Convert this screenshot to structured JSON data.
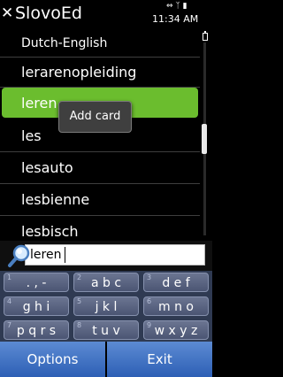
{
  "app": {
    "title": "SlovoEd"
  },
  "status": {
    "time": "11:34 AM"
  },
  "dictionary": {
    "name": "Dutch-English"
  },
  "list": {
    "items": [
      "lerarenopleiding",
      "leren",
      "les",
      "lesauto",
      "lesbienne",
      "lesbisch"
    ],
    "selected": "leren"
  },
  "context_menu": {
    "label": "Add card"
  },
  "search": {
    "value": "leren"
  },
  "keypad": {
    "keys": [
      {
        "num": "1",
        "label": ". , -"
      },
      {
        "num": "2",
        "label": "a b c"
      },
      {
        "num": "3",
        "label": "d e f"
      },
      {
        "num": "4",
        "label": "g h i"
      },
      {
        "num": "5",
        "label": "j k l"
      },
      {
        "num": "6",
        "label": "m n o"
      },
      {
        "num": "7",
        "label": "p q r s"
      },
      {
        "num": "8",
        "label": "t u v"
      },
      {
        "num": "9",
        "label": "w x y z"
      }
    ]
  },
  "softkeys": {
    "left": "Options",
    "right": "Exit"
  },
  "colors": {
    "selection": "#6bbd2e",
    "softkey": "#3a6cc0",
    "keypad": "#2f3a52"
  }
}
